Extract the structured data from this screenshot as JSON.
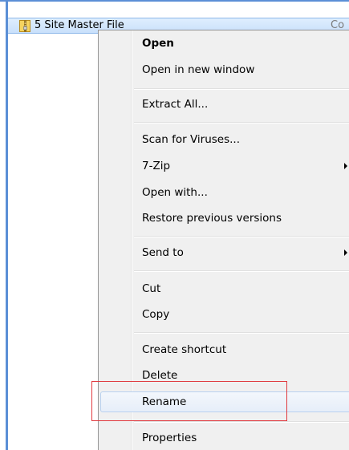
{
  "explorer": {
    "file_name": "5 Site Master File",
    "file_extra": "Co",
    "file_icon": "zip-folder-icon"
  },
  "context_menu": {
    "items": [
      {
        "label": "Open",
        "bold": true
      },
      {
        "label": "Open in new window"
      },
      {
        "label": "Extract All..."
      },
      {
        "label": "Scan for Viruses..."
      },
      {
        "label": "7-Zip",
        "submenu": true
      },
      {
        "label": "Open with..."
      },
      {
        "label": "Restore previous versions"
      },
      {
        "label": "Send to",
        "submenu": true
      },
      {
        "label": "Cut"
      },
      {
        "label": "Copy"
      },
      {
        "label": "Create shortcut"
      },
      {
        "label": "Delete"
      },
      {
        "label": "Rename",
        "highlighted": true
      },
      {
        "label": "Properties"
      }
    ]
  },
  "annotation": {
    "highlight_color": "#e0393e"
  }
}
